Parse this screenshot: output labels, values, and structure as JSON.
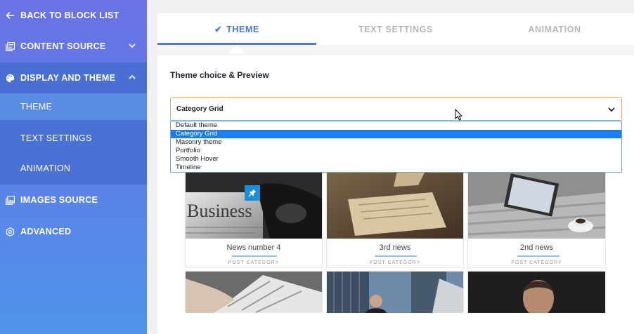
{
  "sidebar": {
    "back_label": "BACK TO BLOCK LIST",
    "items": [
      {
        "label": "CONTENT SOURCE",
        "icon": "library-icon"
      },
      {
        "label": "DISPLAY AND THEME",
        "icon": "palette-icon"
      },
      {
        "label": "IMAGES SOURCE",
        "icon": "images-icon"
      },
      {
        "label": "ADVANCED",
        "icon": "advanced-icon"
      }
    ],
    "sub_items": [
      {
        "label": "THEME"
      },
      {
        "label": "TEXT SETTINGS"
      },
      {
        "label": "ANIMATION"
      }
    ]
  },
  "tabs": [
    {
      "label": "THEME",
      "check": "✔"
    },
    {
      "label": "TEXT SETTINGS"
    },
    {
      "label": "ANIMATION"
    }
  ],
  "section": {
    "label": "Theme choice & Preview"
  },
  "select": {
    "value": "Category Grid",
    "options": [
      "Default theme",
      "Category Grid",
      "Masonry theme",
      "Portfolio",
      "Smooth Hover",
      "Timeline"
    ]
  },
  "cards": [
    {
      "title": "News number 4",
      "category": "POST CATEGORY"
    },
    {
      "title": "3rd news",
      "category": "POST CATEGORY"
    },
    {
      "title": "2nd news",
      "category": "POST CATEGORY"
    }
  ],
  "colors": {
    "accent": "#4a7ad9",
    "sidebar_top": "#6a72e6",
    "sidebar_bottom": "#4f93ea",
    "selected_option": "#1e7bf3",
    "select_border": "#f0a868"
  }
}
